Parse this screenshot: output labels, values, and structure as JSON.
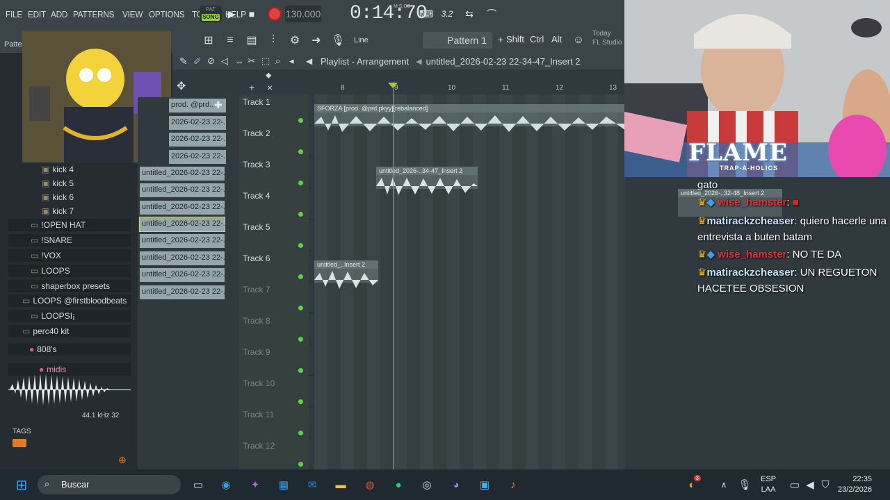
{
  "menu": [
    "FILE",
    "EDIT",
    "ADD",
    "PATTERNS",
    "VIEW",
    "OPTIONS",
    "TOOLS",
    "HELP"
  ],
  "transport": {
    "pat_label": "PAT",
    "song_label": "SONG",
    "tempo": "130.000",
    "time": "0:14:70",
    "time_unit": "M:S:CS",
    "cpu": "3.2"
  },
  "toolbar2": {
    "snap": "Line",
    "pattern": "Pattern 1",
    "keys": [
      "Shift",
      "Ctrl",
      "Alt"
    ],
    "news_line1": "Today",
    "news_line2": "FL Studio"
  },
  "browser": {
    "label": "Patte",
    "items": [
      "kick 4",
      "kick 5",
      "kick 6",
      "kick 7",
      "!OPEN HAT",
      "!SNARE",
      "!VOX",
      "LOOPS",
      "shaperbox presets",
      "LOOPS @firstbloodbeats",
      "LOOPSI¡",
      "perc40 kit",
      "808's",
      "midis"
    ],
    "samplerate": "44.1 kHz 32",
    "tags": "TAGS"
  },
  "pattern_clips": [
    "prod. @prd..",
    "2026-02-23 22-..",
    "2026-02-23 22-..",
    "2026-02-23 22-..",
    "untitled_2026-02-23 22-..",
    "untitled_2026-02-23 22-..",
    "untitled_2026-02-23 22-..",
    "untitled_2026-02-23 22-..",
    "untitled_2026-02-23 22-..",
    "untitled_2026-02-23 22-..",
    "untitled_2026-02-23 22-..",
    "untitled_2026-02-23 22-.."
  ],
  "playlist": {
    "title": "Playlist - Arrangement",
    "file": "untitled_2026-02-23 22-34-47_Insert 2",
    "ruler": [
      "8",
      "9",
      "10",
      "11",
      "12",
      "13"
    ]
  },
  "tracks": [
    "Track 1",
    "Track 2",
    "Track 3",
    "Track 4",
    "Track 5",
    "Track 6",
    "Track 7",
    "Track 8",
    "Track 9",
    "Track 10",
    "Track 11",
    "Track 12"
  ],
  "clips": {
    "c1": "SFORZA [prod. @prd.pkyy][rebalanced]",
    "c2": "untitled_2026-..34-47_Insert 2",
    "c3": "untitled_..Insert 2",
    "c4": "untitled_2026-..32-48_Insert 2"
  },
  "overlay": {
    "flame": "FLAME",
    "flame_sub": "TRAP-A-HOLICS"
  },
  "chat": {
    "l0": "gato",
    "u1": "wise_hamster",
    "t1": ": ",
    "u2": "matirackzcheaser",
    "t2": ": quiero hacerle una entrevista a buten batam",
    "u3": "wise_hamster",
    "t3": ": NO TE DA",
    "u4": "matirackzcheaser",
    "t4": ": UN REGUETON HACETEE OBSESION"
  },
  "taskbar": {
    "search": "Buscar",
    "lang1": "ESP",
    "lang2": "LAA",
    "time": "22:35",
    "date": "23/2/2026",
    "badge": "3"
  },
  "colors": {
    "accent_green": "#9bd22f",
    "record": "#e04040",
    "chat_red": "#e2303a",
    "chat_blue": "#c8dff7"
  }
}
